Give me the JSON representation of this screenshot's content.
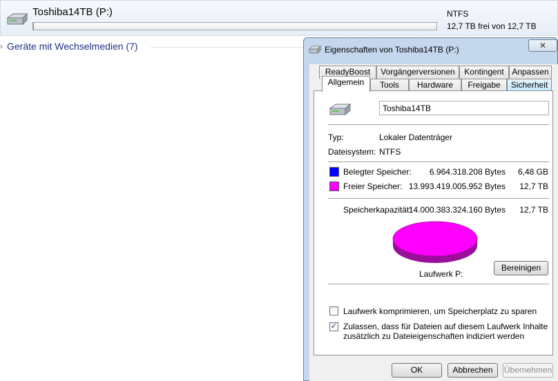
{
  "drive_tile": {
    "name": "Toshiba14TB (P:)",
    "filesystem": "NTFS",
    "free_text": "12,7 TB frei von 12,7 TB",
    "usage_fraction": 0.0005
  },
  "group": {
    "label": "Geräte mit Wechselmedien (7)"
  },
  "dialog": {
    "title": "Eigenschaften von Toshiba14TB (P:)",
    "close_symbol": "✕",
    "tabs_top": [
      "ReadyBoost",
      "Vorgängerversionen",
      "Kontingent",
      "Anpassen"
    ],
    "tabs_bottom": [
      "Allgemein",
      "Tools",
      "Hardware",
      "Freigabe",
      "Sicherheit"
    ],
    "active_tab": "Allgemein",
    "drive_name_value": "Toshiba14TB",
    "type_label": "Typ:",
    "type_value": "Lokaler Datenträger",
    "fs_label": "Dateisystem:",
    "fs_value": "NTFS",
    "used_label": "Belegter Speicher:",
    "used_bytes": "6.964.318.208 Bytes",
    "used_size": "6,48 GB",
    "free_label": "Freier Speicher:",
    "free_bytes": "13.993.419.005.952 Bytes",
    "free_size": "12,7 TB",
    "capacity_label": "Speicherkapazität:",
    "capacity_bytes": "14.000.383.324.160 Bytes",
    "capacity_size": "12,7 TB",
    "drive_label": "Laufwerk P:",
    "cleanup_button": "Bereinigen",
    "compress_label": "Laufwerk komprimieren, um Speicherplatz zu sparen",
    "compress_checked": false,
    "index_label_line1": "Zulassen, dass für Dateien auf diesem Laufwerk Inhalte",
    "index_label_line2": "zusätzlich zu Dateieigenschaften indiziert werden",
    "index_checked": true,
    "check_symbol": "✓",
    "ok_button": "OK",
    "cancel_button": "Abbrechen",
    "apply_button": "Übernehmen",
    "colors": {
      "used": "#0000ff",
      "free": "#ff00ff",
      "free_dark": "#9a0f9a"
    }
  }
}
